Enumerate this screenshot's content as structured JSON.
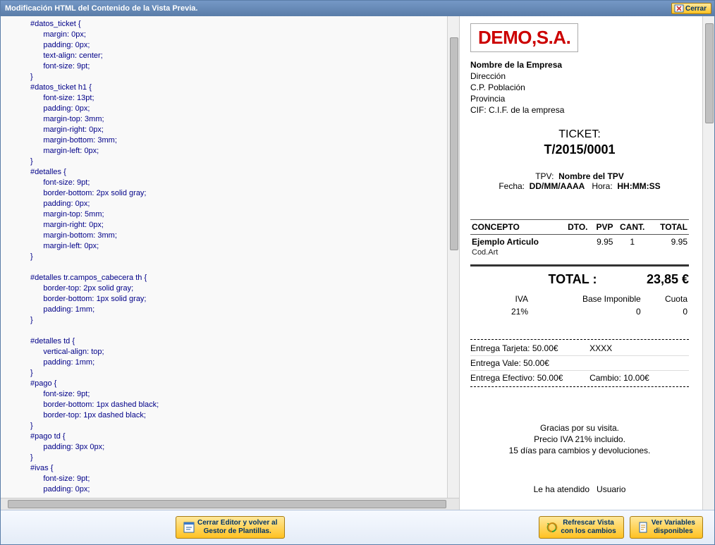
{
  "window": {
    "title": "Modificación HTML del Contenido de la Vista Previa.",
    "close_label": "Cerrar"
  },
  "code_lines": [
    {
      "sel": "#datos_ticket",
      "open": true
    },
    {
      "prop": "margin",
      "val": "0px;"
    },
    {
      "prop": "padding",
      "val": "0px;"
    },
    {
      "prop": "text-align",
      "val": "center;"
    },
    {
      "prop": "font-size",
      "val": "9pt;"
    },
    {
      "close": true
    },
    {
      "sel": "#datos_ticket h1",
      "open": true
    },
    {
      "prop": "font-size",
      "val": "13pt;"
    },
    {
      "prop": "padding",
      "val": "0px;"
    },
    {
      "prop": "margin-top",
      "val": "3mm;"
    },
    {
      "prop": "margin-right",
      "val": "0px;"
    },
    {
      "prop": "margin-bottom",
      "val": "3mm;"
    },
    {
      "prop": "margin-left",
      "val": "0px;"
    },
    {
      "close": true
    },
    {
      "sel": "#detalles",
      "open": true
    },
    {
      "prop": "font-size",
      "val": "9pt;"
    },
    {
      "prop": "border-bottom",
      "val": "2px solid gray;"
    },
    {
      "prop": "padding",
      "val": "0px;"
    },
    {
      "prop": "margin-top",
      "val": "5mm;"
    },
    {
      "prop": "margin-right",
      "val": "0px;"
    },
    {
      "prop": "margin-bottom",
      "val": "3mm;"
    },
    {
      "prop": "margin-left",
      "val": "0px;"
    },
    {
      "close": true
    },
    {
      "blank": true
    },
    {
      "sel": "#detalles tr.campos_cabecera th",
      "open": true
    },
    {
      "prop": "border-top",
      "val": "2px solid gray;"
    },
    {
      "prop": "border-bottom",
      "val": "1px solid gray;"
    },
    {
      "prop": "padding",
      "val": "1mm;"
    },
    {
      "close": true
    },
    {
      "blank": true
    },
    {
      "sel": "#detalles td",
      "open": true
    },
    {
      "prop": "vertical-align",
      "val": "top;"
    },
    {
      "prop": "padding",
      "val": "1mm;"
    },
    {
      "close": true
    },
    {
      "sel": "#pago",
      "open": true
    },
    {
      "prop": "font-size",
      "val": "9pt;"
    },
    {
      "prop": "border-bottom",
      "val": "1px dashed black;"
    },
    {
      "prop": "border-top",
      "val": "1px dashed black;"
    },
    {
      "close": true
    },
    {
      "sel": "#pago td",
      "open": true
    },
    {
      "prop": "padding",
      "val": "3px 0px;"
    },
    {
      "close": true
    },
    {
      "sel": "#ivas",
      "open": true
    },
    {
      "prop": "font-size",
      "val": "9pt;"
    },
    {
      "prop": "padding",
      "val": "0px;"
    }
  ],
  "receipt": {
    "logo_text": "DEMO,S.A.",
    "company": {
      "name": "Nombre de la Empresa",
      "address": "Dirección",
      "city": "C.P. Población",
      "province": "Provincia",
      "cif": "CIF: C.I.F. de la empresa"
    },
    "ticket_label": "TICKET:",
    "ticket_number": "T/2015/0001",
    "tpv_label": "TPV:",
    "tpv_value": "Nombre del TPV",
    "date_label": "Fecha:",
    "date_value": "DD/MM/AAAA",
    "time_label": "Hora:",
    "time_value": "HH:MM:SS",
    "cols": {
      "concepto": "CONCEPTO",
      "dto": "DTO.",
      "pvp": "PVP",
      "cant": "CANT.",
      "total": "TOTAL"
    },
    "items": [
      {
        "name": "Ejemplo Articulo",
        "code": "Cod.Art",
        "dto": "",
        "pvp": "9.95",
        "cant": "1",
        "total": "9.95"
      }
    ],
    "total_label": "TOTAL :",
    "total_value": "23,85 €",
    "iva": {
      "iva_label": "IVA",
      "base_label": "Base Imponible",
      "cuota_label": "Cuota",
      "iva_value": "21%",
      "base_value": "0",
      "cuota_value": "0"
    },
    "payments": [
      {
        "label": "Entrega Tarjeta: 50.00€",
        "extra": "XXXX"
      },
      {
        "label": "Entrega Vale: 50.00€",
        "extra": ""
      },
      {
        "label": "Entrega Efectivo: 50.00€",
        "extra": "Cambio: 10.00€"
      }
    ],
    "footer": [
      "Gracias por su visita.",
      "Precio IVA 21% incluido.",
      "15 días para cambios y devoluciones."
    ],
    "attended_label": "Le ha atendido",
    "attended_value": "Usuario"
  },
  "buttons": {
    "close_editor": "Cerrar Editor y volver al\nGestor de Plantillas.",
    "refresh": "Refrescar Vista\ncon los cambios",
    "variables": "Ver Variables\ndisponibles"
  }
}
